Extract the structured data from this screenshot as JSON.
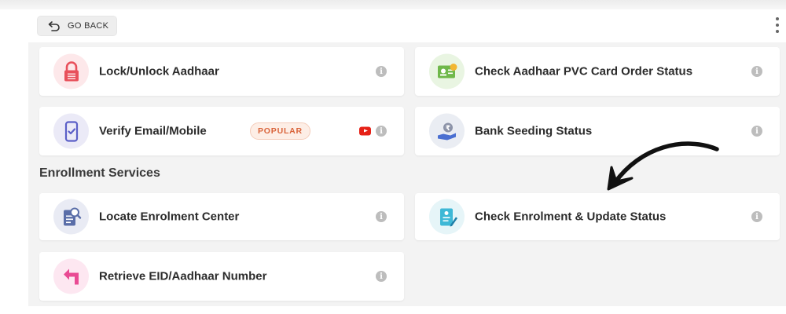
{
  "header": {
    "go_back_label": "GO BACK"
  },
  "cards": {
    "lock_unlock": {
      "title": "Lock/Unlock Aadhaar"
    },
    "pvc_status": {
      "title": "Check Aadhaar PVC Card Order Status"
    },
    "verify_email": {
      "title": "Verify Email/Mobile",
      "badge": "POPULAR"
    },
    "bank_seeding": {
      "title": "Bank Seeding Status"
    },
    "locate_center": {
      "title": "Locate Enrolment Center"
    },
    "enrolment_status": {
      "title": "Check Enrolment & Update Status"
    },
    "retrieve_eid": {
      "title": "Retrieve EID/Aadhaar Number"
    }
  },
  "sections": {
    "enrollment_title": "Enrollment Services"
  },
  "icons": {
    "info": "i",
    "lock": "lock-icon",
    "pvc": "id-card-icon",
    "verify": "phone-check-icon",
    "bank": "rupee-hand-icon",
    "locate": "document-search-icon",
    "status": "document-pen-icon",
    "retrieve": "return-arrow-icon",
    "youtube": "youtube-icon"
  },
  "colors": {
    "accent_badge": "#d9633a",
    "youtube": "#e62117",
    "info": "#bdbdbd"
  }
}
